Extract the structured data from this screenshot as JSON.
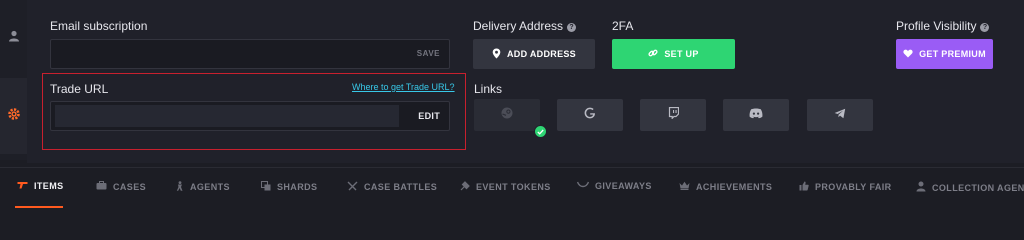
{
  "settings": {
    "email_label": "Email subscription",
    "email_value": "",
    "email_save": "SAVE",
    "trade_label": "Trade URL",
    "trade_help_link": "Where to get Trade URL?",
    "trade_value": "",
    "trade_edit": "EDIT",
    "delivery_label": "Delivery Address",
    "add_address": "ADD ADDRESS",
    "twofa_label": "2FA",
    "set_up": "SET UP",
    "visibility_label": "Profile Visibility",
    "get_premium": "GET PREMIUM",
    "links_label": "Links",
    "links": [
      "steam-icon",
      "google-icon",
      "twitch-icon",
      "discord-icon",
      "telegram-icon"
    ]
  },
  "tabs": [
    {
      "label": "ITEMS",
      "icon": "gun-icon",
      "active": true
    },
    {
      "label": "CASES",
      "icon": "case-icon",
      "active": false
    },
    {
      "label": "AGENTS",
      "icon": "agent-icon",
      "active": false
    },
    {
      "label": "SHARDS",
      "icon": "shards-icon",
      "active": false
    },
    {
      "label": "CASE BATTLES",
      "icon": "battles-icon",
      "active": false
    },
    {
      "label": "EVENT TOKENS",
      "icon": "token-icon",
      "active": false
    },
    {
      "label": "GIVEAWAYS",
      "icon": "giveaway-icon",
      "active": false
    },
    {
      "label": "ACHIEVEMENTS",
      "icon": "crown-icon",
      "active": false
    },
    {
      "label": "PROVABLY FAIR",
      "icon": "thumbs-up-icon",
      "active": false
    },
    {
      "label": "COLLECTION AGENT",
      "icon": "collector-icon",
      "active": false
    }
  ],
  "colors": {
    "accent": "#ff5a1f",
    "success": "#2ed573",
    "premium": "#9a5cf5",
    "link": "#38c8e8",
    "highlight_border": "#c8202e"
  }
}
